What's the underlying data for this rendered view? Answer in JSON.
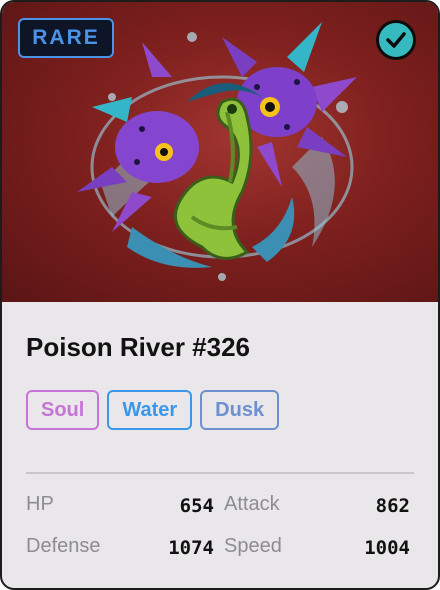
{
  "card": {
    "rarity": "RARE",
    "selected": true,
    "name": "Poison River #326",
    "tags": [
      "Soul",
      "Water",
      "Dusk"
    ],
    "stats": [
      {
        "label": "HP",
        "value": "654"
      },
      {
        "label": "Attack",
        "value": "862"
      },
      {
        "label": "Defense",
        "value": "1074"
      },
      {
        "label": "Speed",
        "value": "1004"
      }
    ]
  },
  "icons": {
    "check": "checkmark-icon",
    "art": "creature-illustration"
  },
  "colors": {
    "art_bg": "#7e201e",
    "rarity": "#4a93e6",
    "check_bg": "#37b9c0",
    "tag_soul": "#c774d8",
    "tag_water": "#3a97ea",
    "tag_dusk": "#6f8fd3"
  }
}
